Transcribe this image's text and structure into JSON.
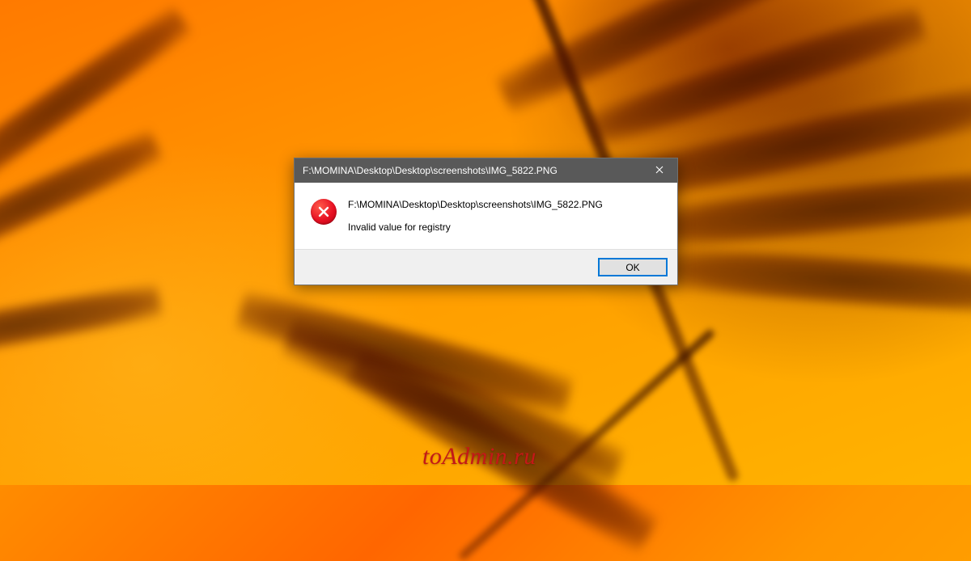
{
  "dialog": {
    "title": "F:\\MOMINA\\Desktop\\Desktop\\screenshots\\IMG_5822.PNG",
    "path": "F:\\MOMINA\\Desktop\\Desktop\\screenshots\\IMG_5822.PNG",
    "message": "Invalid value for registry",
    "ok_label": "OK"
  },
  "watermark": "toAdmin.ru"
}
